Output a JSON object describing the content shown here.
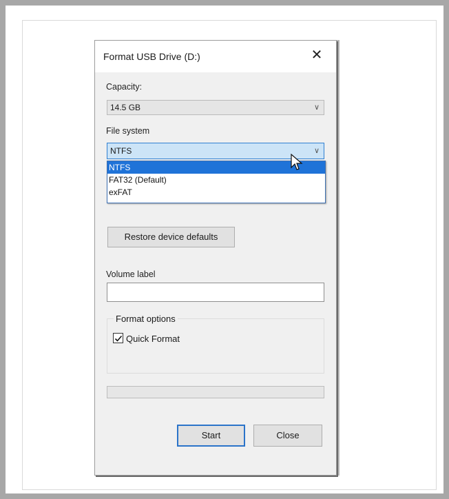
{
  "dialog": {
    "title": "Format USB Drive (D:)",
    "close_symbol": "✕",
    "capacity": {
      "label": "Capacity:",
      "value": "14.5 GB"
    },
    "file_system": {
      "label": "File system",
      "value": "NTFS",
      "options": [
        {
          "label": "NTFS",
          "selected": true
        },
        {
          "label": "FAT32 (Default)",
          "selected": false
        },
        {
          "label": "exFAT",
          "selected": false
        }
      ]
    },
    "restore_button": "Restore device defaults",
    "volume_label": {
      "label": "Volume label",
      "value": ""
    },
    "format_options": {
      "title": "Format options",
      "quick_format": {
        "label": "Quick Format",
        "checked": true
      }
    },
    "progress": 0,
    "buttons": {
      "start": "Start",
      "close": "Close"
    }
  },
  "colors": {
    "frame_border": "#a7a7a7",
    "dialog_bg": "#f0f0f0",
    "selection_blue": "#1f73d8",
    "active_combo": "#cce4f7",
    "default_button_border": "#2a73c9"
  },
  "icons": [
    "close-icon",
    "chevron-down-icon",
    "mouse-pointer-icon",
    "checkmark-icon"
  ]
}
